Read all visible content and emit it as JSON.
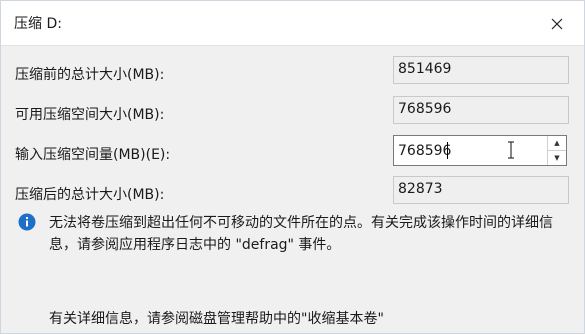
{
  "dialog": {
    "title": "压缩 D:",
    "close_icon": "close-icon"
  },
  "fields": {
    "total_before_label": "压缩前的总计大小(MB):",
    "total_before_value": "851469",
    "available_label": "可用压缩空间大小(MB):",
    "available_value": "768596",
    "shrink_amount_label": "输入压缩空间量(MB)(E):",
    "shrink_amount_value": "768596",
    "total_after_label": "压缩后的总计大小(MB):",
    "total_after_value": "82873"
  },
  "info": {
    "icon": "info-icon",
    "message": "无法将卷压缩到超出任何不可移动的文件所在的点。有关完成该操作时间的详细信息，请参阅应用程序日志中的 \"defrag\" 事件。"
  },
  "help": {
    "text": "有关详细信息，请参阅磁盘管理帮助中的\"收缩基本卷\""
  },
  "colors": {
    "info_icon": "#1e6fc8"
  }
}
